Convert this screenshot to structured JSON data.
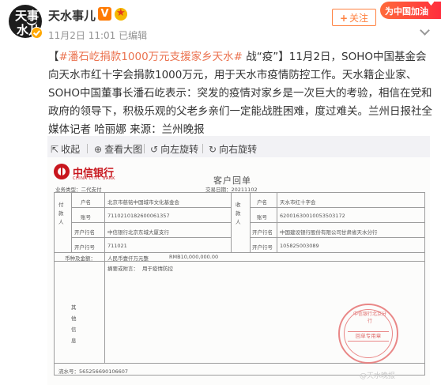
{
  "account": {
    "name": "天水事儿",
    "avatar_chars": [
      "天事",
      "水儿"
    ],
    "meta": "11月2日 11:01  已编辑",
    "follow_label": "关注",
    "follow_icon": "plus-icon",
    "verified_color": "#ffa800"
  },
  "promo": {
    "label": "为中国加油"
  },
  "post": {
    "hashtag": "#潘石屹捐款1000万元支援家乡天水#",
    "body": " 战“疫”】11月2日，SOHO中国基金会向天水市红十字会捐款1000万元，用于天水市疫情防控工作。天水籍企业家、SOHO中国董事长潘石屹表示：突发的疫情对家乡是一次巨大的考验，相信在党和政府的领导下，积极乐观的父老乡亲们一定能战胜困难，度过难关。兰州日报社全媒体记者 哈丽娜 来源：兰州晚报"
  },
  "toolbar": {
    "collapse": "收起",
    "view_large": "查看大图",
    "rotate_left": "向左旋转",
    "rotate_right": "向右旋转"
  },
  "receipt": {
    "bank_name": "中信银行",
    "bank_en": "CHINA CITIC BANK",
    "title": "客户回单",
    "biz_type_label": "业务类型：",
    "biz_type": "二代支付",
    "trade_date_label": "交易日期：",
    "trade_date": "20211102",
    "payer_label": "付款人",
    "payee_label": "收款人",
    "name_label": "户名",
    "account_label": "账号",
    "open_bank_label": "开户行名",
    "bank_no_label": "开户行号",
    "payer_name": "北京市慈铭中国城市文化基金会",
    "payer_account": "7110210182600061357",
    "payer_bank": "中信银行北京东城大厦支行",
    "payer_bank_no": "711021",
    "payee_name": "天水市红十字会",
    "payee_account": "62001630010053503172",
    "payee_bank": "中国建设银行股份有限公司甘肃省天水分行",
    "payee_bank_no": "105825003089",
    "amount_label": "币种及金额：",
    "amount_cn": "人民币壹仟万元整",
    "amount_num": "RMB10,000,000.00",
    "purpose_label": "摘要或附言：",
    "purpose": "用于疫情防控",
    "other_info_label": "其他信息",
    "serial_label": "流水号：",
    "serial": "565256690106607",
    "stamp_ring": "中信银行北京分行",
    "stamp_text": "回单专用章"
  },
  "watermark": "@天水晚报"
}
